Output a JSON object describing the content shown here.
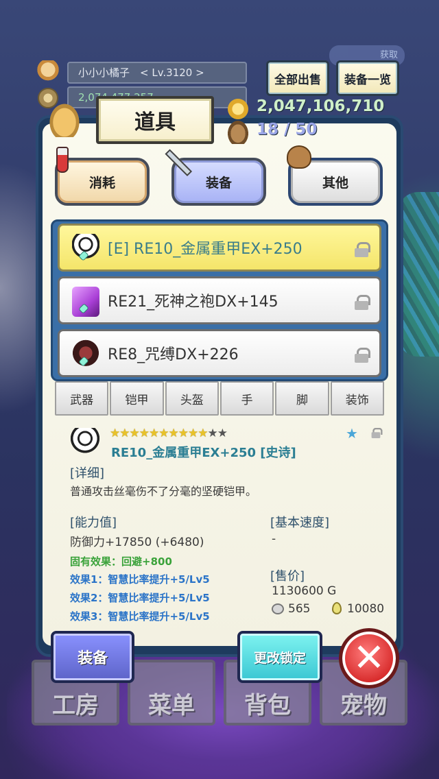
{
  "hud": {
    "player_name": "小小小橘子　< Lv.3120 >",
    "gold_partial": "2,074,477,257",
    "obtain_label": "获取"
  },
  "top_buttons": {
    "sell_all": "全部出售",
    "equip_list": "装备一览"
  },
  "panel": {
    "title": "道具",
    "gold": "2,047,106,710",
    "capacity": "18 / 50"
  },
  "category_tabs": [
    {
      "label": "消耗"
    },
    {
      "label": "装备"
    },
    {
      "label": "其他"
    }
  ],
  "items": [
    {
      "label": "[E] RE10_金属重甲EX+250",
      "selected": true,
      "icon": "white-armor-icon"
    },
    {
      "label": "RE21_死神之袍DX+145",
      "selected": false,
      "icon": "purple-robe-icon"
    },
    {
      "label": "RE8_咒缚DX+226",
      "selected": false,
      "icon": "dark-armor-icon"
    }
  ],
  "filters": [
    "武器",
    "铠甲",
    "头盔",
    "手",
    "脚",
    "装饰"
  ],
  "detail": {
    "stars_filled": 10,
    "stars_total": 12,
    "name": "RE10_金属重甲EX+250 [史诗]",
    "detail_heading": "[详细]",
    "description": "普通攻击丝毫伤不了分毫的坚硬铠甲。",
    "ability_heading": "[能力值]",
    "defense": "防御力+17850 (+6480)",
    "inherent_effect": "固有效果：回避+800",
    "effect1": "效果1：智慧比率提升+5/Lv5",
    "effect2": "效果2：智慧比率提升+5/Lv5",
    "effect3": "效果3：智慧比率提升+5/Lv5",
    "speed_heading": "[基本速度]",
    "speed_value": "-",
    "price_heading": "[售价]",
    "price": "1130600 G",
    "ore": "565",
    "drops": "10080"
  },
  "actions": {
    "equip": "装备",
    "change_lock": "更改锁定",
    "close": "✕"
  },
  "nav": [
    "工房",
    "菜单",
    "背包",
    "宠物"
  ],
  "colors": {
    "panel_frame": "#1e3b5e",
    "selected_row": "#fff79c",
    "equip_tab": "#a7b2f5",
    "gold_text": "#cfefc9",
    "rarity_name": "#2b7e93"
  }
}
